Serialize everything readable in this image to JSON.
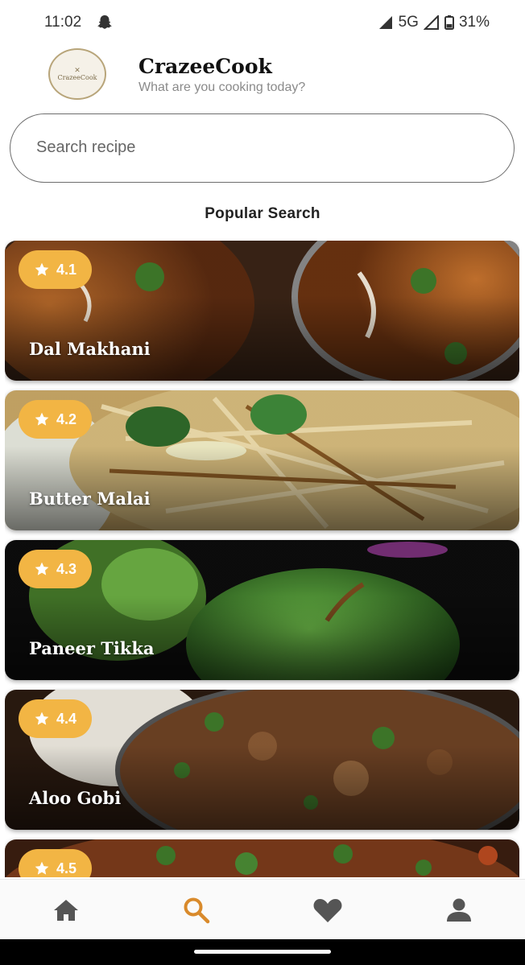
{
  "status_bar": {
    "time": "11:02",
    "network": "5G",
    "battery": "31%"
  },
  "header": {
    "logo_text": "CrazeeCook",
    "title": "CrazeeCook",
    "subtitle": "What are you cooking today?"
  },
  "search": {
    "placeholder": "Search recipe",
    "value": ""
  },
  "section_title": "Popular Search",
  "recipes": [
    {
      "name": "Dal Makhani",
      "rating": "4.1"
    },
    {
      "name": "Butter Malai",
      "rating": "4.2"
    },
    {
      "name": "Paneer Tikka",
      "rating": "4.3"
    },
    {
      "name": "Aloo Gobi",
      "rating": "4.4"
    },
    {
      "name": "",
      "rating": "4.5"
    }
  ],
  "bottom_nav": {
    "items": [
      {
        "icon": "home-icon",
        "active": false
      },
      {
        "icon": "search-icon",
        "active": true
      },
      {
        "icon": "heart-icon",
        "active": false
      },
      {
        "icon": "person-icon",
        "active": false
      }
    ]
  },
  "colors": {
    "rating_badge": "#f2b544",
    "nav_active": "#d98a2b",
    "nav_inactive": "#555555"
  }
}
